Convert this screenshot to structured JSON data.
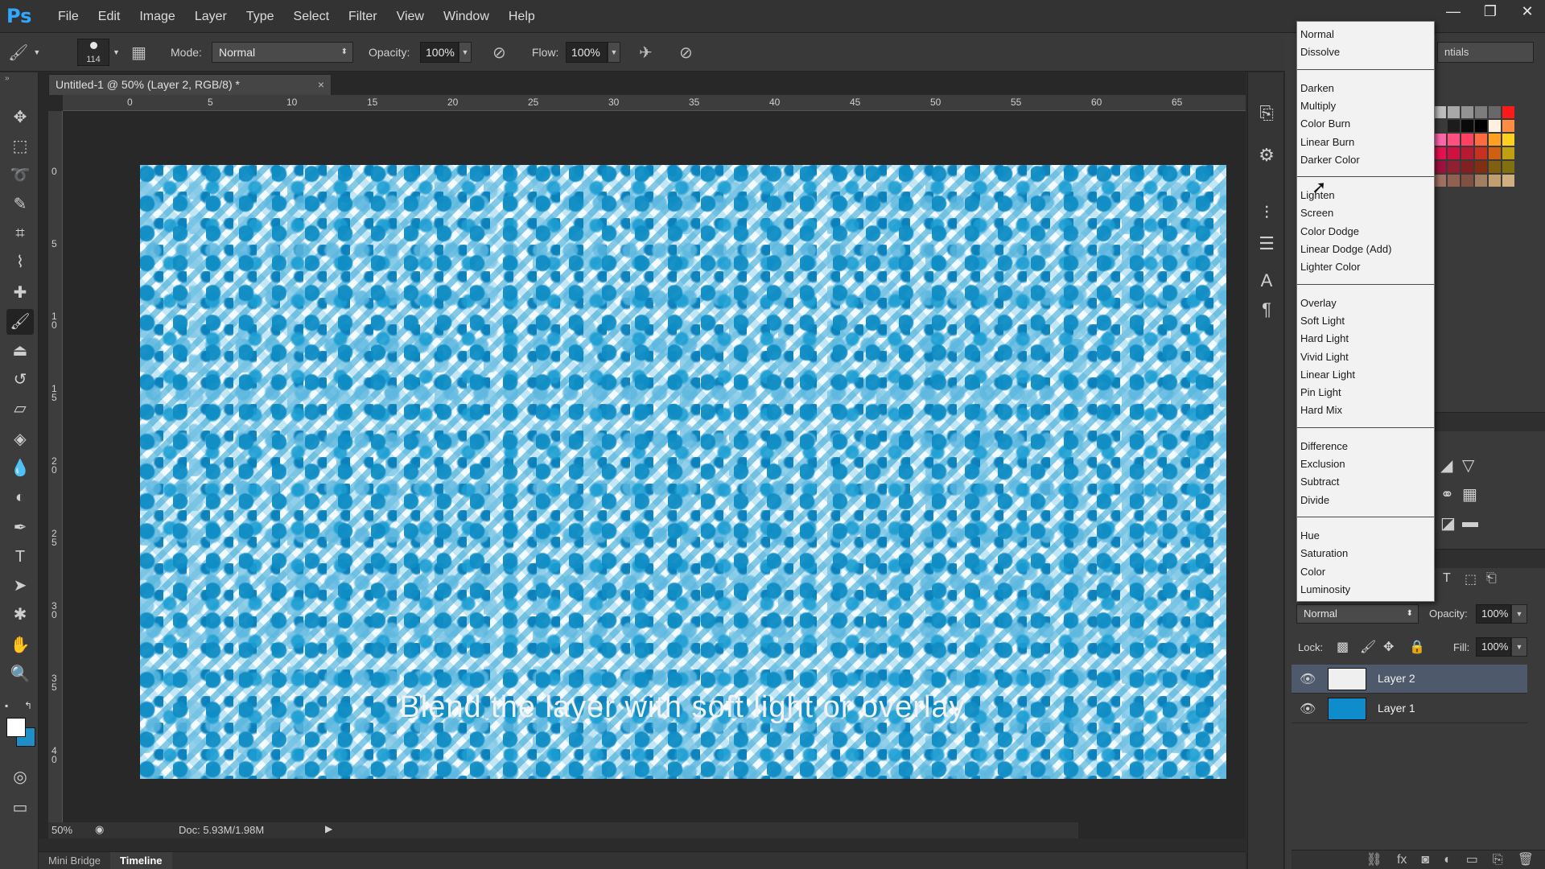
{
  "app": {
    "logo": "Ps"
  },
  "menu": [
    "File",
    "Edit",
    "Image",
    "Layer",
    "Type",
    "Select",
    "Filter",
    "View",
    "Window",
    "Help"
  ],
  "options": {
    "brush_size": "114",
    "mode_label": "Mode:",
    "mode_value": "Normal",
    "opacity_label": "Opacity:",
    "opacity_value": "100%",
    "flow_label": "Flow:",
    "flow_value": "100%"
  },
  "document": {
    "tab_title": "Untitled-1 @ 50% (Layer 2, RGB/8) *",
    "close": "×",
    "ruler_h": [
      "0",
      "5",
      "10",
      "15",
      "20",
      "25",
      "30",
      "35",
      "40",
      "45",
      "50",
      "55",
      "60",
      "65"
    ],
    "ruler_v": [
      "0",
      "5",
      "1\n0",
      "1\n5",
      "2\n0",
      "2\n5",
      "3\n0",
      "3\n5",
      "4\n0"
    ],
    "zoom": "50%",
    "doc_info": "Doc: 5.93M/1.98M"
  },
  "caption": "Blend the layer with soft light or overlay",
  "bottom_tabs": [
    "Mini Bridge",
    "Timeline"
  ],
  "workspace": "ntials",
  "blend_menu": {
    "groups": [
      [
        "Normal",
        "Dissolve"
      ],
      [
        "Darken",
        "Multiply",
        "Color Burn",
        "Linear Burn",
        "Darker Color"
      ],
      [
        "Lighten",
        "Screen",
        "Color Dodge",
        "Linear Dodge (Add)",
        "Lighter Color"
      ],
      [
        "Overlay",
        "Soft Light",
        "Hard Light",
        "Vivid Light",
        "Linear Light",
        "Pin Light",
        "Hard Mix"
      ],
      [
        "Difference",
        "Exclusion",
        "Subtract",
        "Divide"
      ],
      [
        "Hue",
        "Saturation",
        "Color",
        "Luminosity"
      ]
    ]
  },
  "layers_panel": {
    "blend_value": "Normal",
    "opacity_label": "Opacity:",
    "opacity_value": "100%",
    "lock_label": "Lock:",
    "fill_label": "Fill:",
    "fill_value": "100%",
    "layers": [
      {
        "name": "Layer 2",
        "selected": true
      },
      {
        "name": "Layer 1",
        "selected": false
      }
    ]
  },
  "colors": {
    "foreground": "#ffffff",
    "background": "#1e8fc6",
    "layer1_fill": "#0f8ccc"
  },
  "icons": {
    "window_controls": [
      "minimize-icon",
      "restore-icon",
      "close-icon"
    ],
    "tools": [
      "move-icon",
      "marquee-icon",
      "lasso-icon",
      "quick-select-icon",
      "crop-icon",
      "eyedropper-icon",
      "healing-icon",
      "brush-icon",
      "stamp-icon",
      "history-brush-icon",
      "eraser-icon",
      "paint-bucket-icon",
      "blur-icon",
      "dodge-icon",
      "pen-icon",
      "type-icon",
      "path-select-icon",
      "shape-icon",
      "hand-icon",
      "zoom-icon",
      "quick-mask-icon",
      "screen-mode-icon"
    ]
  }
}
